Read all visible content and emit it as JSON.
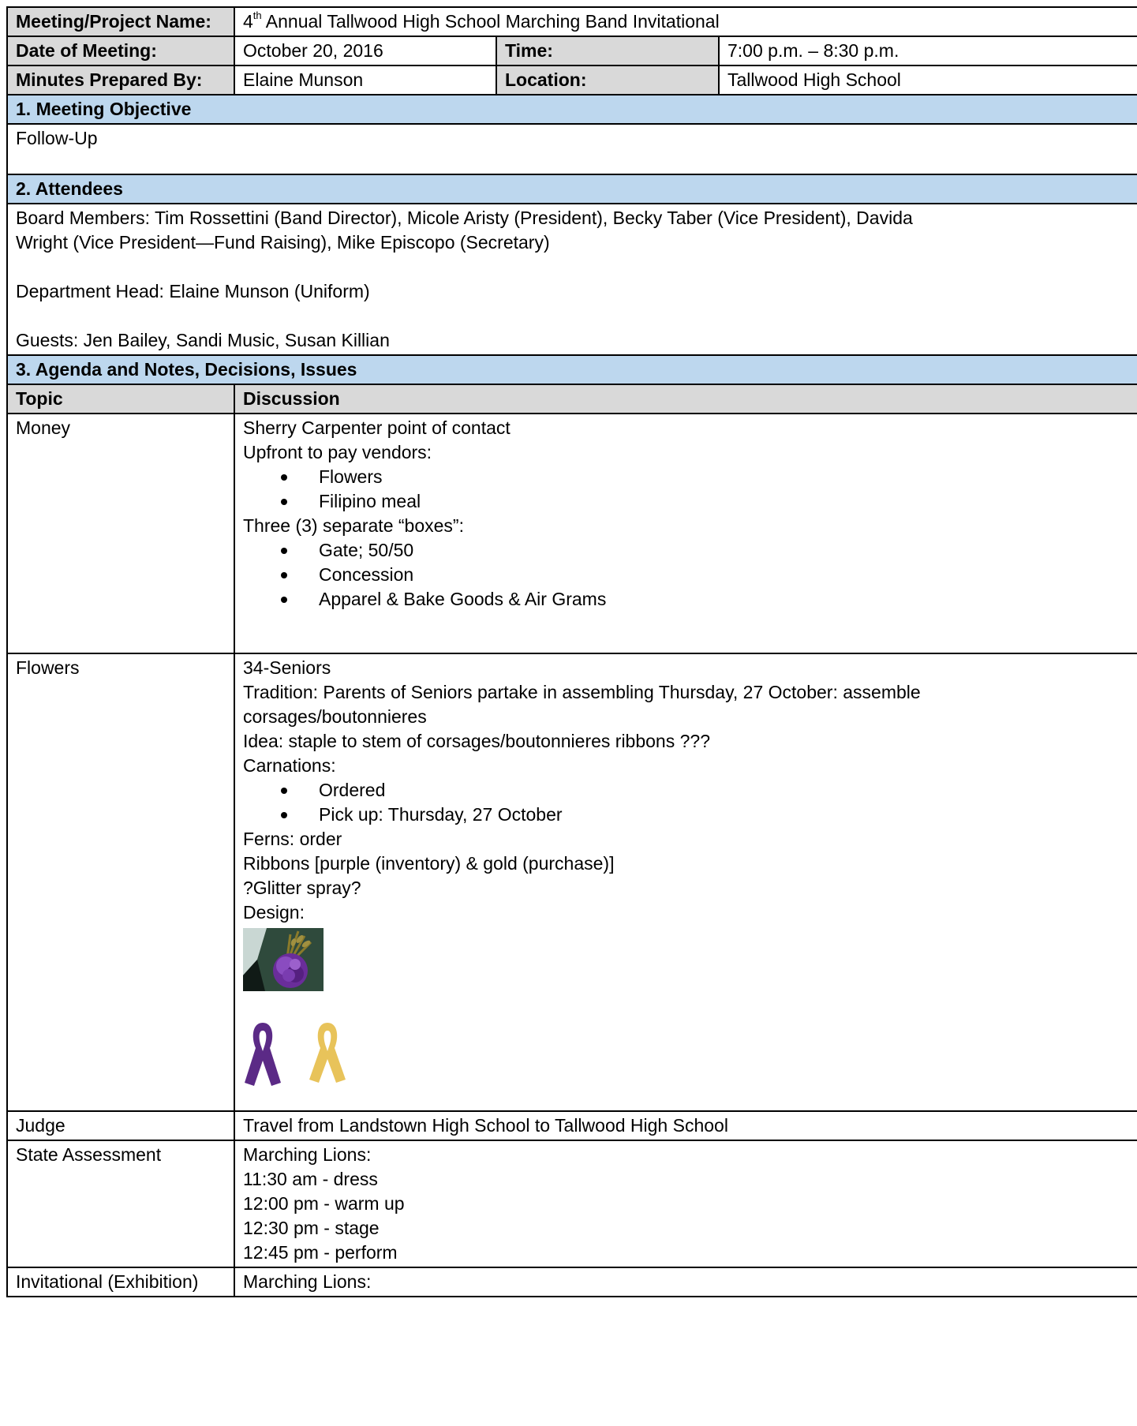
{
  "header": {
    "project_label": "Meeting/Project Name:",
    "project_value_ordinal": "4",
    "project_value_sup": "th",
    "project_value_rest": "Annual Tallwood High School Marching Band Invitational",
    "date_label": "Date of Meeting:",
    "date_value": "October 20, 2016",
    "time_label": "Time:",
    "time_value": "7:00 p.m. – 8:30 p.m.",
    "prepared_label": "Minutes Prepared By:",
    "prepared_value": "Elaine Munson",
    "location_label": "Location:",
    "location_value": "Tallwood High School"
  },
  "objective": {
    "heading": "1. Meeting Objective",
    "text": "Follow-Up"
  },
  "attendees": {
    "heading": "2. Attendees",
    "board_line1": "Board Members: Tim Rossettini (Band Director), Micole Aristy (President), Becky Taber (Vice President), Davida",
    "board_line2": "Wright (Vice President—Fund Raising), Mike Episcopo (Secretary)",
    "department": "Department Head: Elaine Munson (Uniform)",
    "guests": "Guests: Jen Bailey, Sandi Music, Susan Killian"
  },
  "agenda": {
    "heading": "3. Agenda and Notes, Decisions, Issues",
    "topic_header": "Topic",
    "discussion_header": "Discussion",
    "money": {
      "topic": "Money",
      "line1": "Sherry Carpenter point of contact",
      "line2": "Upfront to pay vendors:",
      "bullets1": [
        "Flowers",
        "Filipino meal"
      ],
      "line3": "Three (3) separate “boxes”:",
      "bullets2": [
        "Gate; 50/50",
        "Concession",
        "Apparel & Bake Goods & Air Grams"
      ]
    },
    "flowers": {
      "topic": "Flowers",
      "line1": "34-Seniors",
      "line2": "Tradition: Parents of Seniors partake in assembling Thursday, 27 October: assemble",
      "line3": "corsages/boutonnieres",
      "line4": "Idea: staple to stem of corsages/boutonnieres ribbons ???",
      "line5": "Carnations:",
      "bullets": [
        "Ordered",
        "Pick up: Thursday, 27 October"
      ],
      "line6": "Ferns: order",
      "line7": "Ribbons [purple (inventory) & gold (purchase)]",
      "line8": "?Glitter spray?",
      "line9": "Design:"
    },
    "judge": {
      "topic": "Judge",
      "line1": "Travel from Landstown High School to Tallwood High School"
    },
    "state": {
      "topic": "State Assessment",
      "line1": "Marching Lions:",
      "line2": "11:30 am - dress",
      "line3": "12:00 pm - warm up",
      "line4": "12:30 pm - stage",
      "line5": "12:45 pm - perform"
    },
    "invitational": {
      "topic": "Invitational (Exhibition)",
      "line1": "Marching Lions:"
    }
  },
  "colors": {
    "label_bg": "#d9d9d9",
    "section_bg": "#bdd7ee",
    "ribbon_purple": "#5b2a86",
    "ribbon_gold": "#e8c35a"
  },
  "icons": [
    "carnation-photo",
    "purple-ribbon-icon",
    "gold-ribbon-icon"
  ]
}
